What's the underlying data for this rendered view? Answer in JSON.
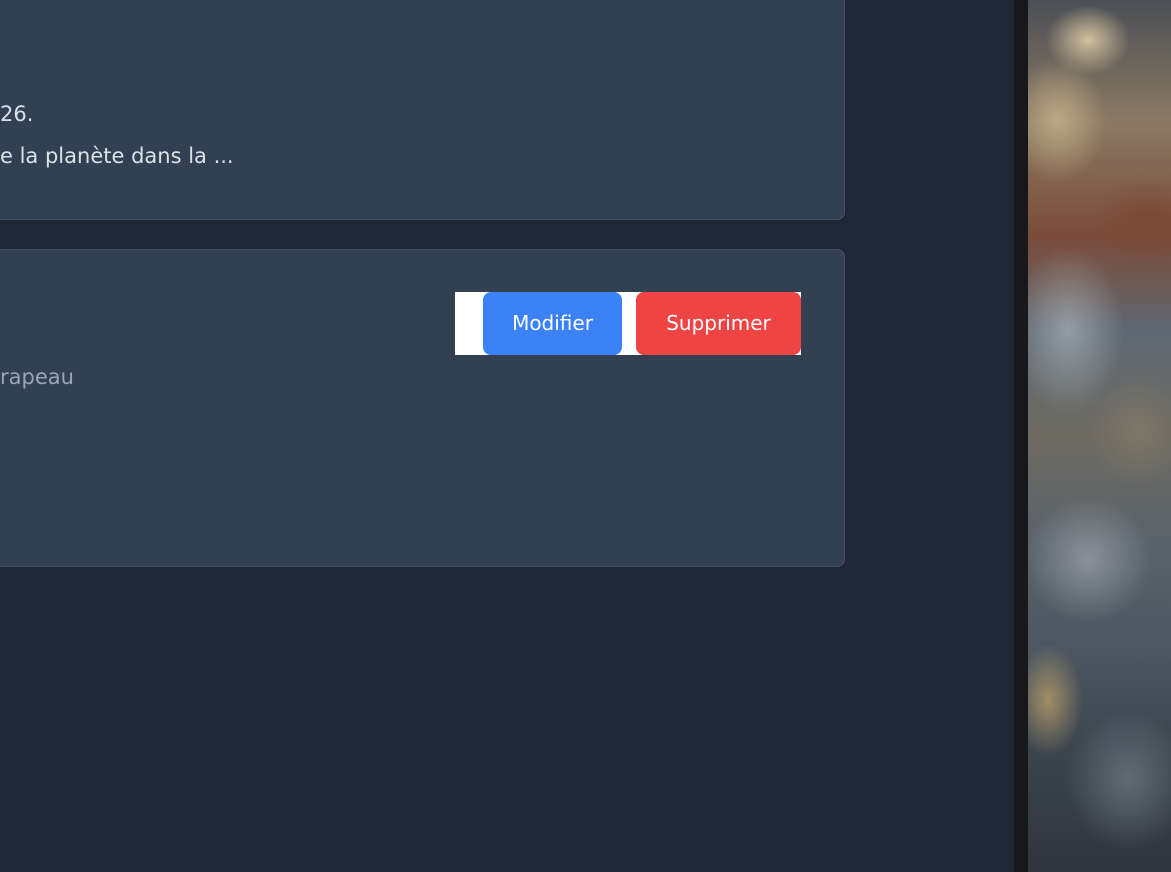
{
  "card1": {
    "line_a": "26.",
    "line_b": "e la planète dans la ..."
  },
  "card2": {
    "meta": "rapeau",
    "edit_label": "Modifier",
    "delete_label": "Supprimer"
  },
  "colors": {
    "background": "#1f2737",
    "card": "#334052",
    "edit_button": "#3b82f6",
    "delete_button": "#ef4444"
  }
}
